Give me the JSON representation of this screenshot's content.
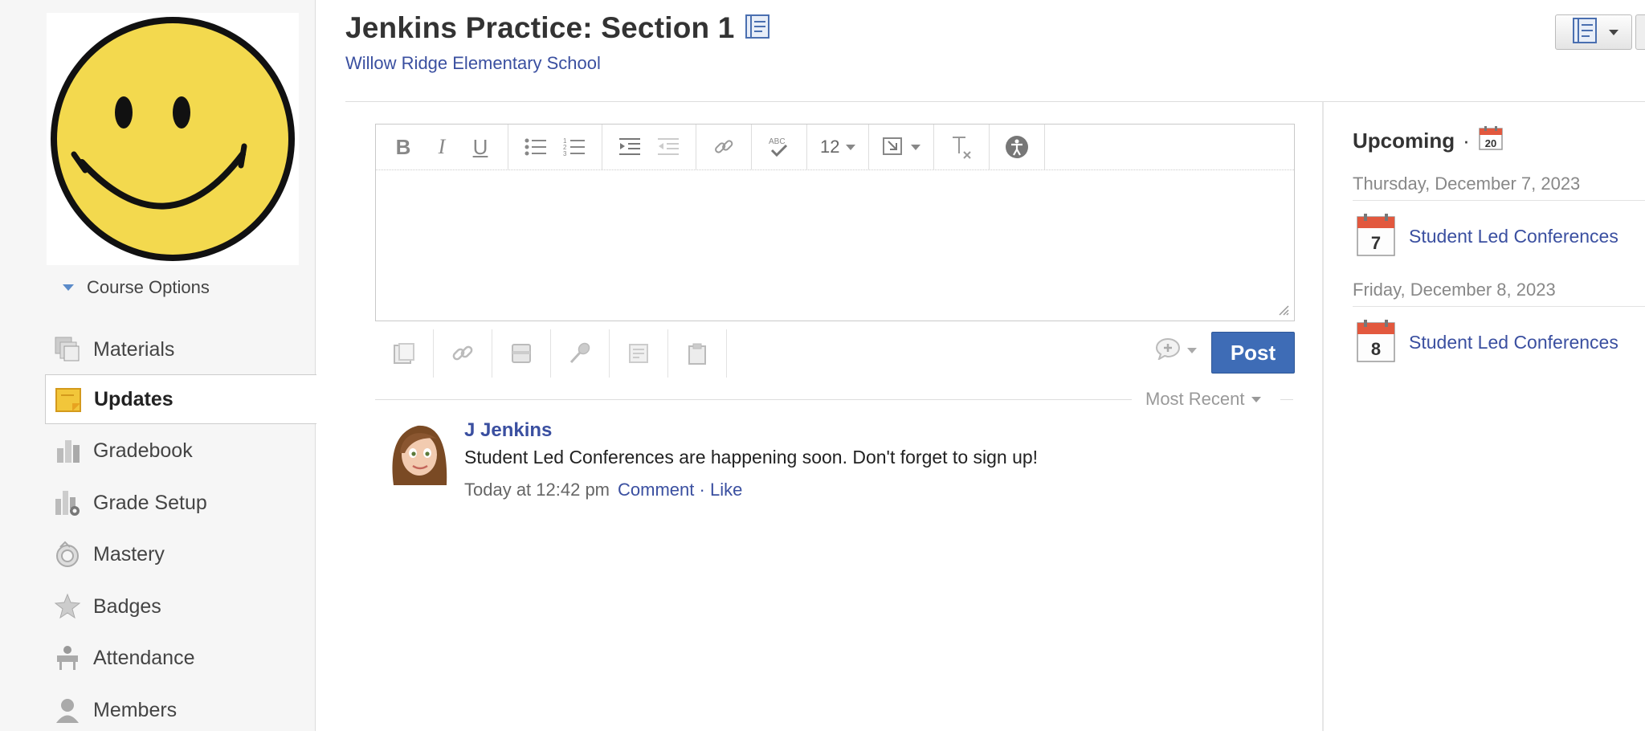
{
  "sidebar": {
    "course_options": "Course Options",
    "items": [
      {
        "label": "Materials",
        "icon": "materials-icon"
      },
      {
        "label": "Updates",
        "icon": "updates-icon",
        "active": true
      },
      {
        "label": "Gradebook",
        "icon": "gradebook-icon"
      },
      {
        "label": "Grade Setup",
        "icon": "grade-setup-icon"
      },
      {
        "label": "Mastery",
        "icon": "mastery-icon"
      },
      {
        "label": "Badges",
        "icon": "badges-icon"
      },
      {
        "label": "Attendance",
        "icon": "attendance-icon"
      },
      {
        "label": "Members",
        "icon": "members-icon"
      }
    ]
  },
  "header": {
    "title": "Jenkins Practice: Section 1",
    "school": "Willow Ridge Elementary School"
  },
  "editor": {
    "font_size": "12",
    "toolbar_icons": [
      "bold-icon",
      "italic-icon",
      "underline-icon",
      "bulleted-list-icon",
      "numbered-list-icon",
      "indent-icon",
      "outdent-icon",
      "link-icon",
      "spellcheck-icon",
      "font-size-select",
      "insert-content-icon",
      "clear-format-icon",
      "accessibility-icon"
    ]
  },
  "composer": {
    "post_label": "Post",
    "sort_label": "Most Recent"
  },
  "post": {
    "author": "J Jenkins",
    "body": "Student Led Conferences are happening soon. Don't forget to sign up!",
    "time": "Today at 12:42 pm",
    "comment": "Comment",
    "separator": "·",
    "like": "Like"
  },
  "upcoming": {
    "title": "Upcoming",
    "separator": "·",
    "calendar_day": "20",
    "days": [
      {
        "date": "Thursday, December 7, 2023",
        "day_num": "7",
        "event": "Student Led Conferences"
      },
      {
        "date": "Friday, December 8, 2023",
        "day_num": "8",
        "event": "Student Led Conferences"
      }
    ]
  },
  "colors": {
    "accent": "#3e6cb6",
    "link": "#3a4fa0",
    "sidebar_bg": "#f6f6f6",
    "smiley_yellow": "#f3d94e",
    "calendar_red": "#e2583e"
  }
}
